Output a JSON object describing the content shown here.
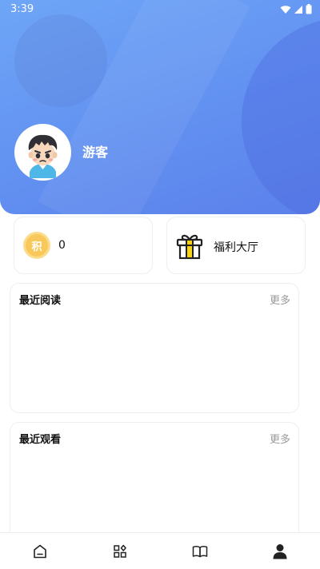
{
  "status": {
    "time": "3:39"
  },
  "profile": {
    "username": "游客"
  },
  "points": {
    "badge": "积",
    "value": "0"
  },
  "welfare": {
    "label": "福利大厅"
  },
  "sections": [
    {
      "title": "最近阅读",
      "more": "更多"
    },
    {
      "title": "最近观看",
      "more": "更多"
    }
  ],
  "tabbar": {
    "tabs": [
      {
        "icon": "home-icon",
        "active": false
      },
      {
        "icon": "category-icon",
        "active": false
      },
      {
        "icon": "book-icon",
        "active": false
      },
      {
        "icon": "profile-icon",
        "active": true
      }
    ]
  },
  "colors": {
    "header_gradient_start": "#6ea6f7",
    "header_gradient_end": "#5b80ea",
    "points_badge": "#f9c85a",
    "gift_accent": "#f7d21a"
  }
}
